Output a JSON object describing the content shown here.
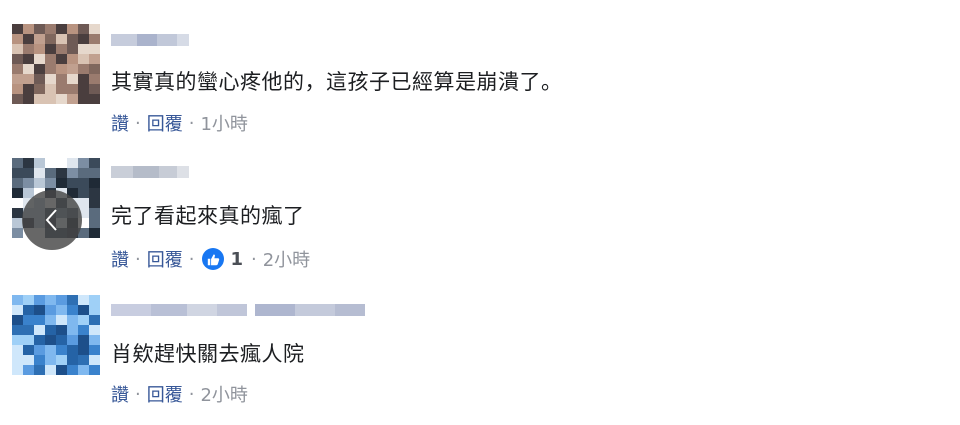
{
  "comments": [
    {
      "text": "其實真的蠻心疼他的，這孩子已經算是崩潰了。",
      "actions": {
        "like": "讚",
        "reply": "回覆",
        "time": "1小時"
      }
    },
    {
      "text": "完了看起來真的瘋了",
      "actions": {
        "like": "讚",
        "reply": "回覆",
        "reaction_count": "1",
        "time": "2小時"
      }
    },
    {
      "text": "肖欸趕快關去瘋人院",
      "actions": {
        "like": "讚",
        "reply": "回覆",
        "time": "2小時"
      }
    }
  ],
  "separator": "·",
  "icons": {
    "reaction": "like-reaction-icon",
    "nav": "chevron-left-icon"
  },
  "colors": {
    "link": "#385898",
    "text": "#1c1e21",
    "meta": "#90949c",
    "like_blue": "#1877f2"
  }
}
